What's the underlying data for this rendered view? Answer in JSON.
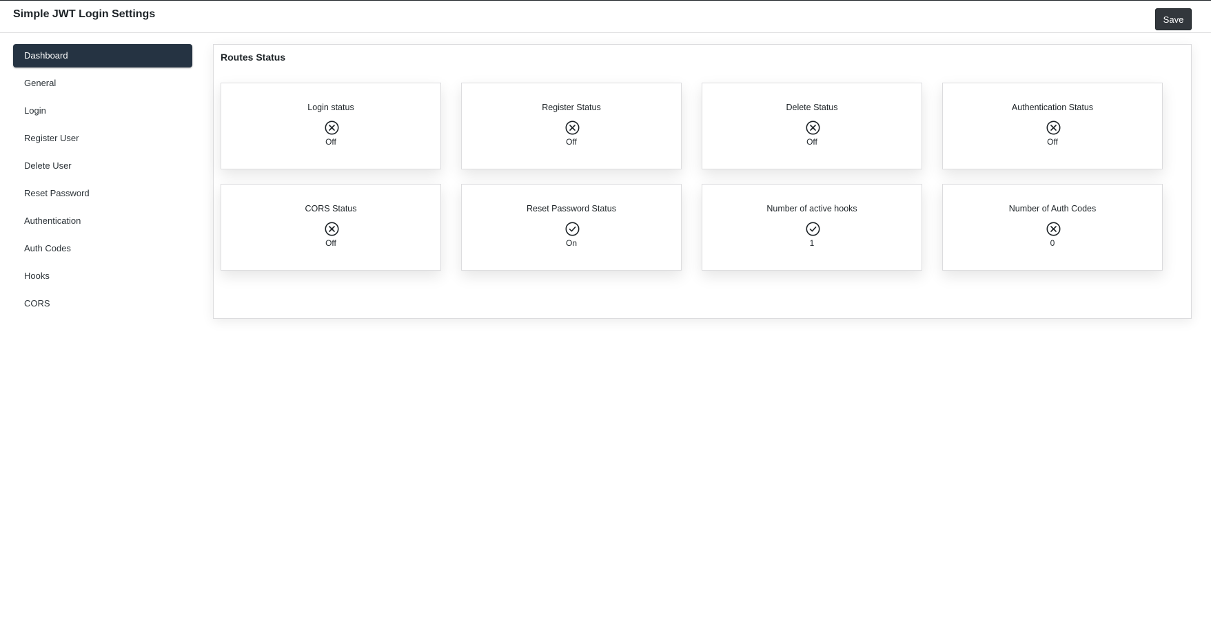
{
  "header": {
    "title": "Simple JWT Login Settings",
    "save_label": "Save"
  },
  "sidebar": {
    "items": [
      {
        "label": "Dashboard",
        "active": true
      },
      {
        "label": "General"
      },
      {
        "label": "Login"
      },
      {
        "label": "Register User"
      },
      {
        "label": "Delete User"
      },
      {
        "label": "Reset Password"
      },
      {
        "label": "Authentication"
      },
      {
        "label": "Auth Codes"
      },
      {
        "label": "Hooks"
      },
      {
        "label": "CORS"
      }
    ]
  },
  "main": {
    "title": "Routes Status",
    "cards": [
      {
        "title": "Login status",
        "icon": "x-circle-icon",
        "value": "Off"
      },
      {
        "title": "Register Status",
        "icon": "x-circle-icon",
        "value": "Off"
      },
      {
        "title": "Delete Status",
        "icon": "x-circle-icon",
        "value": "Off"
      },
      {
        "title": "Authentication Status",
        "icon": "x-circle-icon",
        "value": "Off"
      },
      {
        "title": "CORS Status",
        "icon": "x-circle-icon",
        "value": "Off"
      },
      {
        "title": "Reset Password Status",
        "icon": "check-circle-icon",
        "value": "On"
      },
      {
        "title": "Number of active hooks",
        "icon": "check-circle-icon",
        "value": "1"
      },
      {
        "title": "Number of Auth Codes",
        "icon": "x-circle-icon",
        "value": "0"
      }
    ]
  },
  "colors": {
    "active_nav": "#253342",
    "save_button": "#32373c",
    "text": "#1d2327",
    "border": "#dcdcde"
  }
}
